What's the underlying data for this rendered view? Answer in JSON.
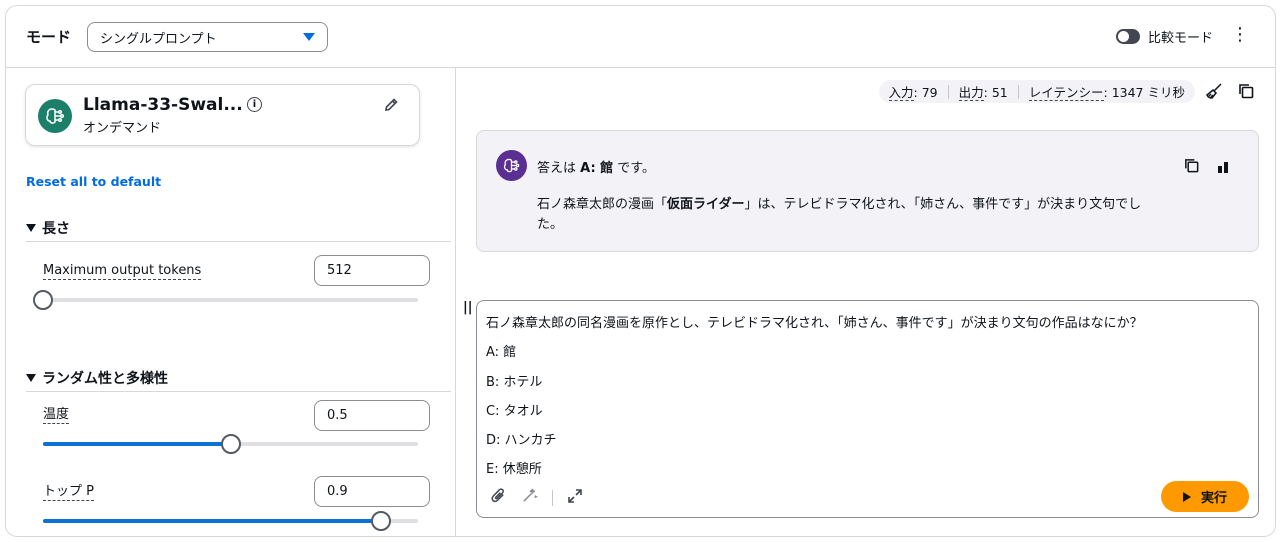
{
  "header": {
    "mode_label": "モード",
    "mode_value": "シングルプロンプト",
    "compare_label": "比較モード",
    "more_menu": "⋮"
  },
  "model": {
    "name": "Llama-33-Swal...",
    "subtitle": "オンデマンド",
    "info_glyph": "i",
    "avatar_icon": "brain-circuit-icon",
    "avatar_color": "#1b7f69"
  },
  "reset_label": "Reset all to default",
  "sections": {
    "length": {
      "title": "長さ",
      "params": [
        {
          "label": "Maximum output tokens",
          "value": "512",
          "level": 0.0
        }
      ]
    },
    "randomness": {
      "title": "ランダム性と多様性",
      "params": [
        {
          "label": "温度",
          "value": "0.5",
          "level": 0.5
        },
        {
          "label": "トップ P",
          "value": "0.9",
          "level": 0.9
        }
      ]
    }
  },
  "metrics": {
    "input_label": "入力",
    "input_value": ": 79",
    "output_label": "出力",
    "output_value": ": 51",
    "latency_label": "レイテンシー",
    "latency_value": ": 1347 ミリ秒"
  },
  "response": {
    "avatar_color": "#5b2e91",
    "head_prefix": "答えは ",
    "head_bold": "A: 館",
    "head_suffix": " です。",
    "body_prefix": "石ノ森章太郎の漫画「",
    "body_bold": "仮面ライダー",
    "body_suffix": "」は、テレビドラマ化され、「姉さん、事件です」が決まり文句でした。"
  },
  "prompt": {
    "drag_handle": "||",
    "lines": [
      "石ノ森章太郎の同名漫画を原作とし、テレビドラマ化され、「姉さん、事件です」が決まり文句の作品はなにか？",
      "A: 館",
      "B: ホテル",
      "C: タオル",
      "D: ハンカチ",
      "E: 休憩所"
    ],
    "run_label": "実行"
  },
  "colors": {
    "accent": "#0972d3",
    "run_button": "#ff9900"
  }
}
